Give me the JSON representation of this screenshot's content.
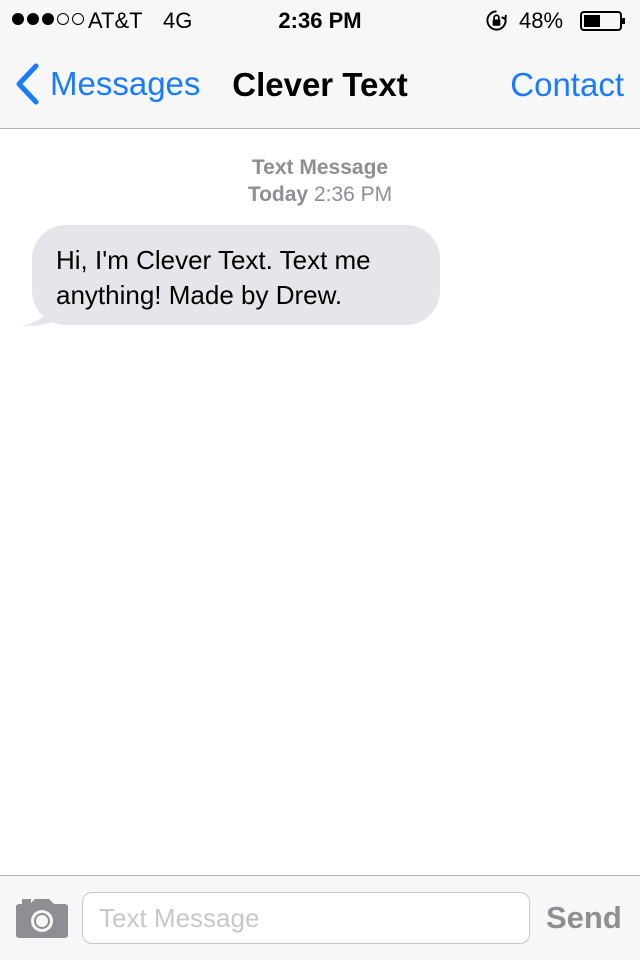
{
  "status_bar": {
    "signal_filled": 3,
    "signal_total": 5,
    "carrier": "AT&T",
    "network": "4G",
    "time": "2:36 PM",
    "battery_percent": "48%",
    "battery_level": 0.48,
    "orientation_lock_icon": "rotation-lock-icon"
  },
  "nav_bar": {
    "back_label": "Messages",
    "back_icon": "chevron-left-icon",
    "title": "Clever Text",
    "right_label": "Contact"
  },
  "thread": {
    "header_line1": "Text Message",
    "header_day": "Today",
    "header_time": "2:36 PM",
    "messages": [
      {
        "direction": "incoming",
        "lines": [
          "Hi, I'm Clever Text. Text me",
          "anything! Made by Drew."
        ]
      }
    ]
  },
  "input_bar": {
    "camera_icon": "camera-icon",
    "placeholder": "Text Message",
    "value": "",
    "send_label": "Send"
  },
  "colors": {
    "accent": "#1a7bff",
    "bar_background": "#f7f7f7",
    "bubble_incoming": "#e5e5ea",
    "muted_text": "#8e8e93"
  }
}
